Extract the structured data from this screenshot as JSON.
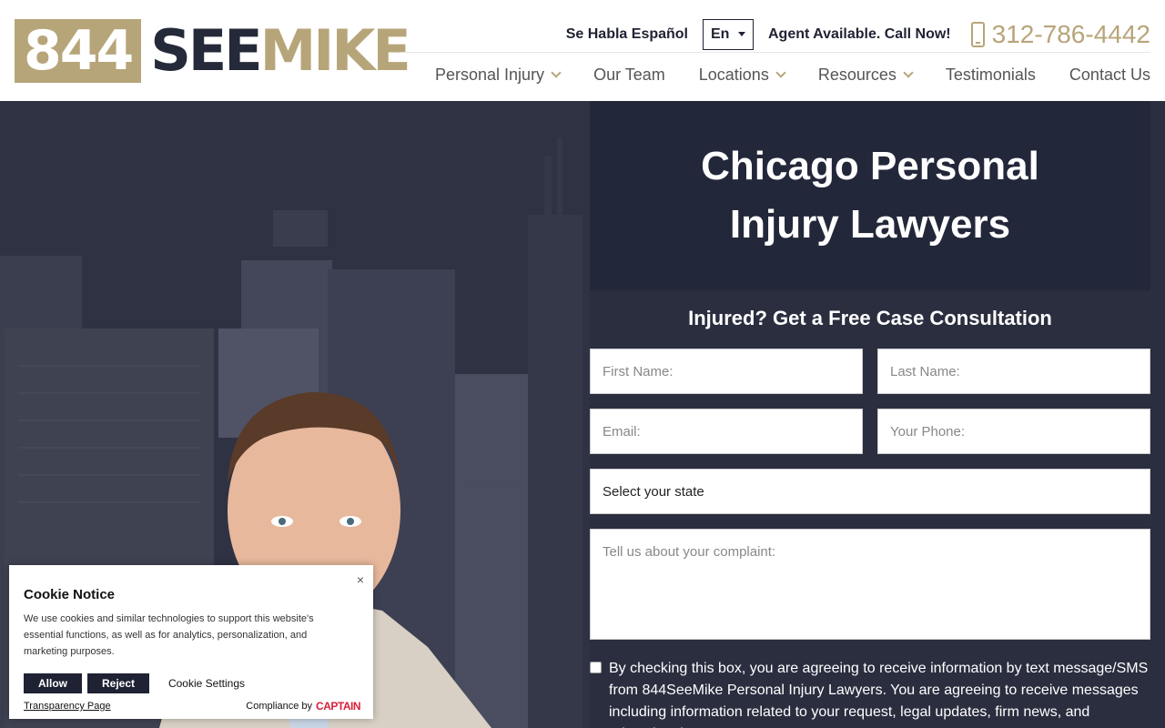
{
  "header": {
    "logo": {
      "number": "844",
      "see": "SEE",
      "mike": "MIKE"
    },
    "habla": "Se Habla Español",
    "language": "En",
    "agent": "Agent Available. Call Now!",
    "phone": "312-786-4442"
  },
  "nav": [
    {
      "label": "Personal Injury",
      "dropdown": true
    },
    {
      "label": "Our Team",
      "dropdown": false
    },
    {
      "label": "Locations",
      "dropdown": true
    },
    {
      "label": "Resources",
      "dropdown": true
    },
    {
      "label": "Testimonials",
      "dropdown": false
    },
    {
      "label": "Contact Us",
      "dropdown": false
    }
  ],
  "hero": {
    "title": "Chicago Personal Injury Lawyers"
  },
  "form": {
    "heading": "Injured? Get a Free Case Consultation",
    "first_name": "First Name:",
    "last_name": "Last Name:",
    "email": "Email:",
    "phone": "Your Phone:",
    "state": "Select your state",
    "complaint": "Tell us about your complaint:",
    "consent": "By checking this box, you are agreeing to receive information by text message/SMS from 844SeeMike Personal Injury Lawyers. You are agreeing to receive messages including information related to your request, legal updates, firm news, and educational content"
  },
  "cookie": {
    "title": "Cookie Notice",
    "text": "We use cookies and similar technologies to support this website's essential functions, as well as for analytics, personalization, and marketing purposes.",
    "allow": "Allow",
    "reject": "Reject",
    "settings": "Cookie Settings",
    "transparency": "Transparency Page",
    "compliance": "Compliance by",
    "captain": "CAPTAIN",
    "close": "×"
  },
  "colors": {
    "gold": "#b7a57a",
    "navy": "#23273a",
    "ink": "#1f2233"
  }
}
